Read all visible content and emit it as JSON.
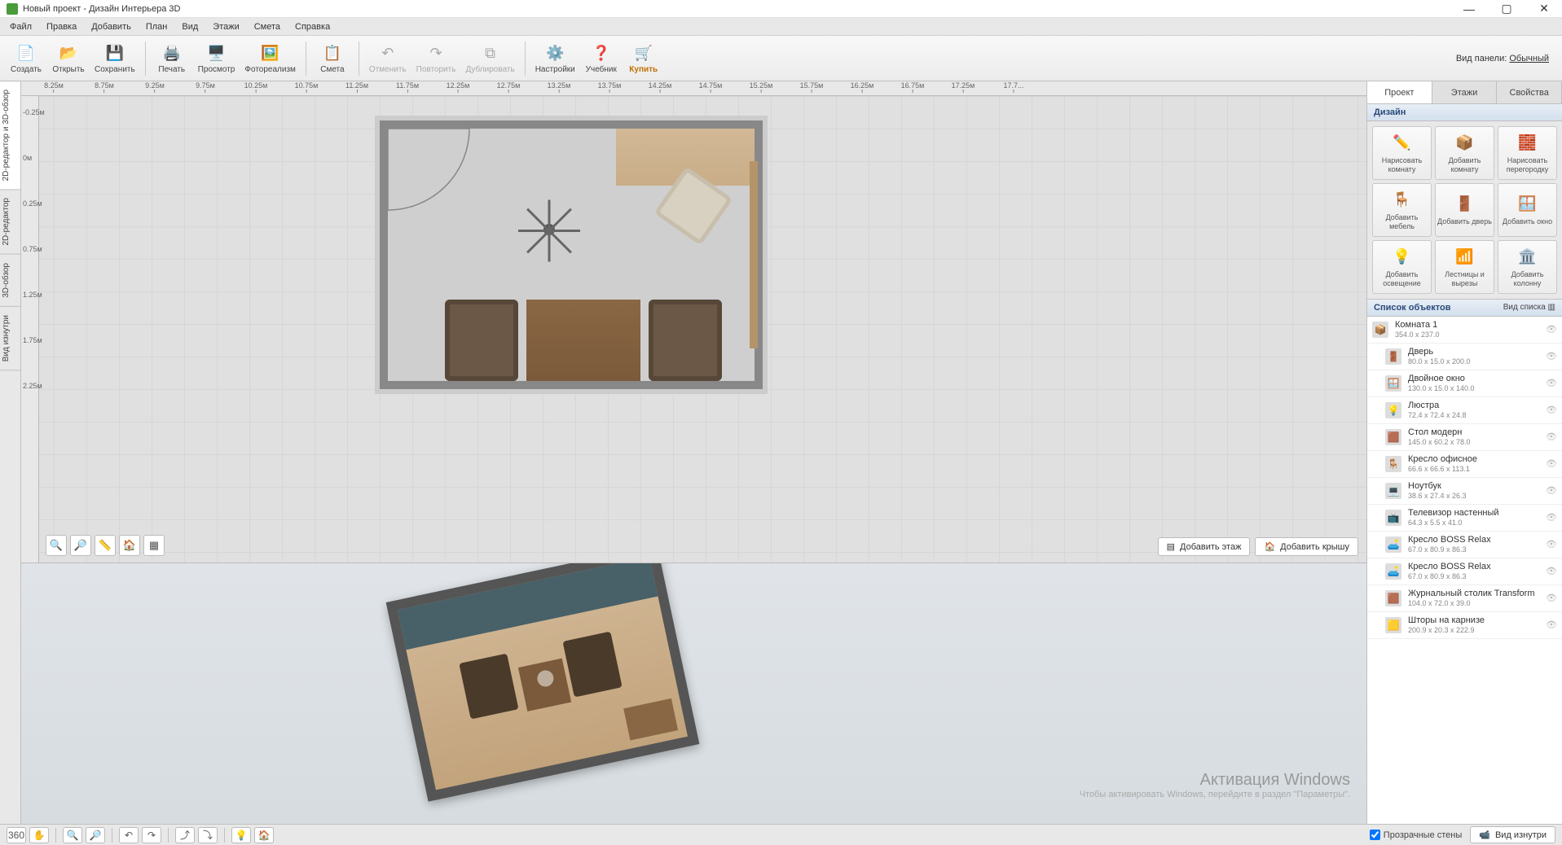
{
  "window": {
    "title": "Новый проект - Дизайн Интерьера 3D"
  },
  "menu": {
    "file": "Файл",
    "edit": "Правка",
    "add": "Добавить",
    "plan": "План",
    "view": "Вид",
    "floors": "Этажи",
    "estimate": "Смета",
    "help": "Справка"
  },
  "toolbar": {
    "create": "Создать",
    "open": "Открыть",
    "save": "Сохранить",
    "print": "Печать",
    "preview": "Просмотр",
    "photorealism": "Фотореализм",
    "estimate": "Смета",
    "undo": "Отменить",
    "redo": "Повторить",
    "duplicate": "Дублировать",
    "settings": "Настройки",
    "textbook": "Учебник",
    "buy": "Купить",
    "panel_mode_label": "Вид панели:",
    "panel_mode_value": "Обычный"
  },
  "left_tabs": {
    "t1": "2D-редактор и 3D-обзор",
    "t2": "2D-редактор",
    "t3": "3D-обзор",
    "t4": "Вид изнутри"
  },
  "ruler_h": [
    "8.25м",
    "8.75м",
    "9.25м",
    "9.75м",
    "10.25м",
    "10.75м",
    "11.25м",
    "11.75м",
    "12.25м",
    "12.75м",
    "13.25м",
    "13.75м",
    "14.25м",
    "14.75м",
    "15.25м",
    "15.75м",
    "16.25м",
    "16.75м",
    "17.25м",
    "17.7..."
  ],
  "ruler_v": [
    "-0.25м",
    "0м",
    "0.25м",
    "0.75м",
    "1.25м",
    "1.75м",
    "2.25м"
  ],
  "view2d_buttons": {
    "add_floor": "Добавить этаж",
    "add_roof": "Добавить крышу"
  },
  "right_panel": {
    "tab_project": "Проект",
    "tab_floors": "Этажи",
    "tab_properties": "Свойства",
    "design_title": "Дизайн",
    "design_buttons": {
      "draw_room": "Нарисовать комнату",
      "add_room": "Добавить комнату",
      "draw_partition": "Нарисовать перегородку",
      "add_furniture": "Добавить мебель",
      "add_door": "Добавить дверь",
      "add_window": "Добавить окно",
      "add_lighting": "Добавить освещение",
      "stairs_cutout": "Лестницы и вырезы",
      "add_column": "Добавить колонну"
    },
    "objects_title": "Список объектов",
    "view_list": "Вид списка"
  },
  "objects": [
    {
      "name": "Комната 1",
      "dim": "354.0 x 237.0",
      "root": true
    },
    {
      "name": "Дверь",
      "dim": "80.0 x 15.0 x 200.0"
    },
    {
      "name": "Двойное окно",
      "dim": "130.0 x 15.0 x 140.0"
    },
    {
      "name": "Люстра",
      "dim": "72.4 x 72.4 x 24.8"
    },
    {
      "name": "Стол модерн",
      "dim": "145.0 x 60.2 x 78.0"
    },
    {
      "name": "Кресло офисное",
      "dim": "66.6 x 66.6 x 113.1"
    },
    {
      "name": "Ноутбук",
      "dim": "38.6 x 27.4 x 26.3"
    },
    {
      "name": "Телевизор настенный",
      "dim": "64.3 x 5.5 x 41.0"
    },
    {
      "name": "Кресло BOSS Relax",
      "dim": "67.0 x 80.9 x 86.3"
    },
    {
      "name": "Кресло BOSS Relax",
      "dim": "67.0 x 80.9 x 86.3"
    },
    {
      "name": "Журнальный столик Transform",
      "dim": "104.0 x 72.0 x 39.0"
    },
    {
      "name": "Шторы на карнизе",
      "dim": "200.9 x 20.3 x 222.9"
    }
  ],
  "bottombar": {
    "transparent_walls": "Прозрачные стены",
    "inside_view": "Вид изнутри"
  },
  "watermark": {
    "title": "Активация Windows",
    "sub": "Чтобы активировать Windows, перейдите в раздел \"Параметры\"."
  }
}
